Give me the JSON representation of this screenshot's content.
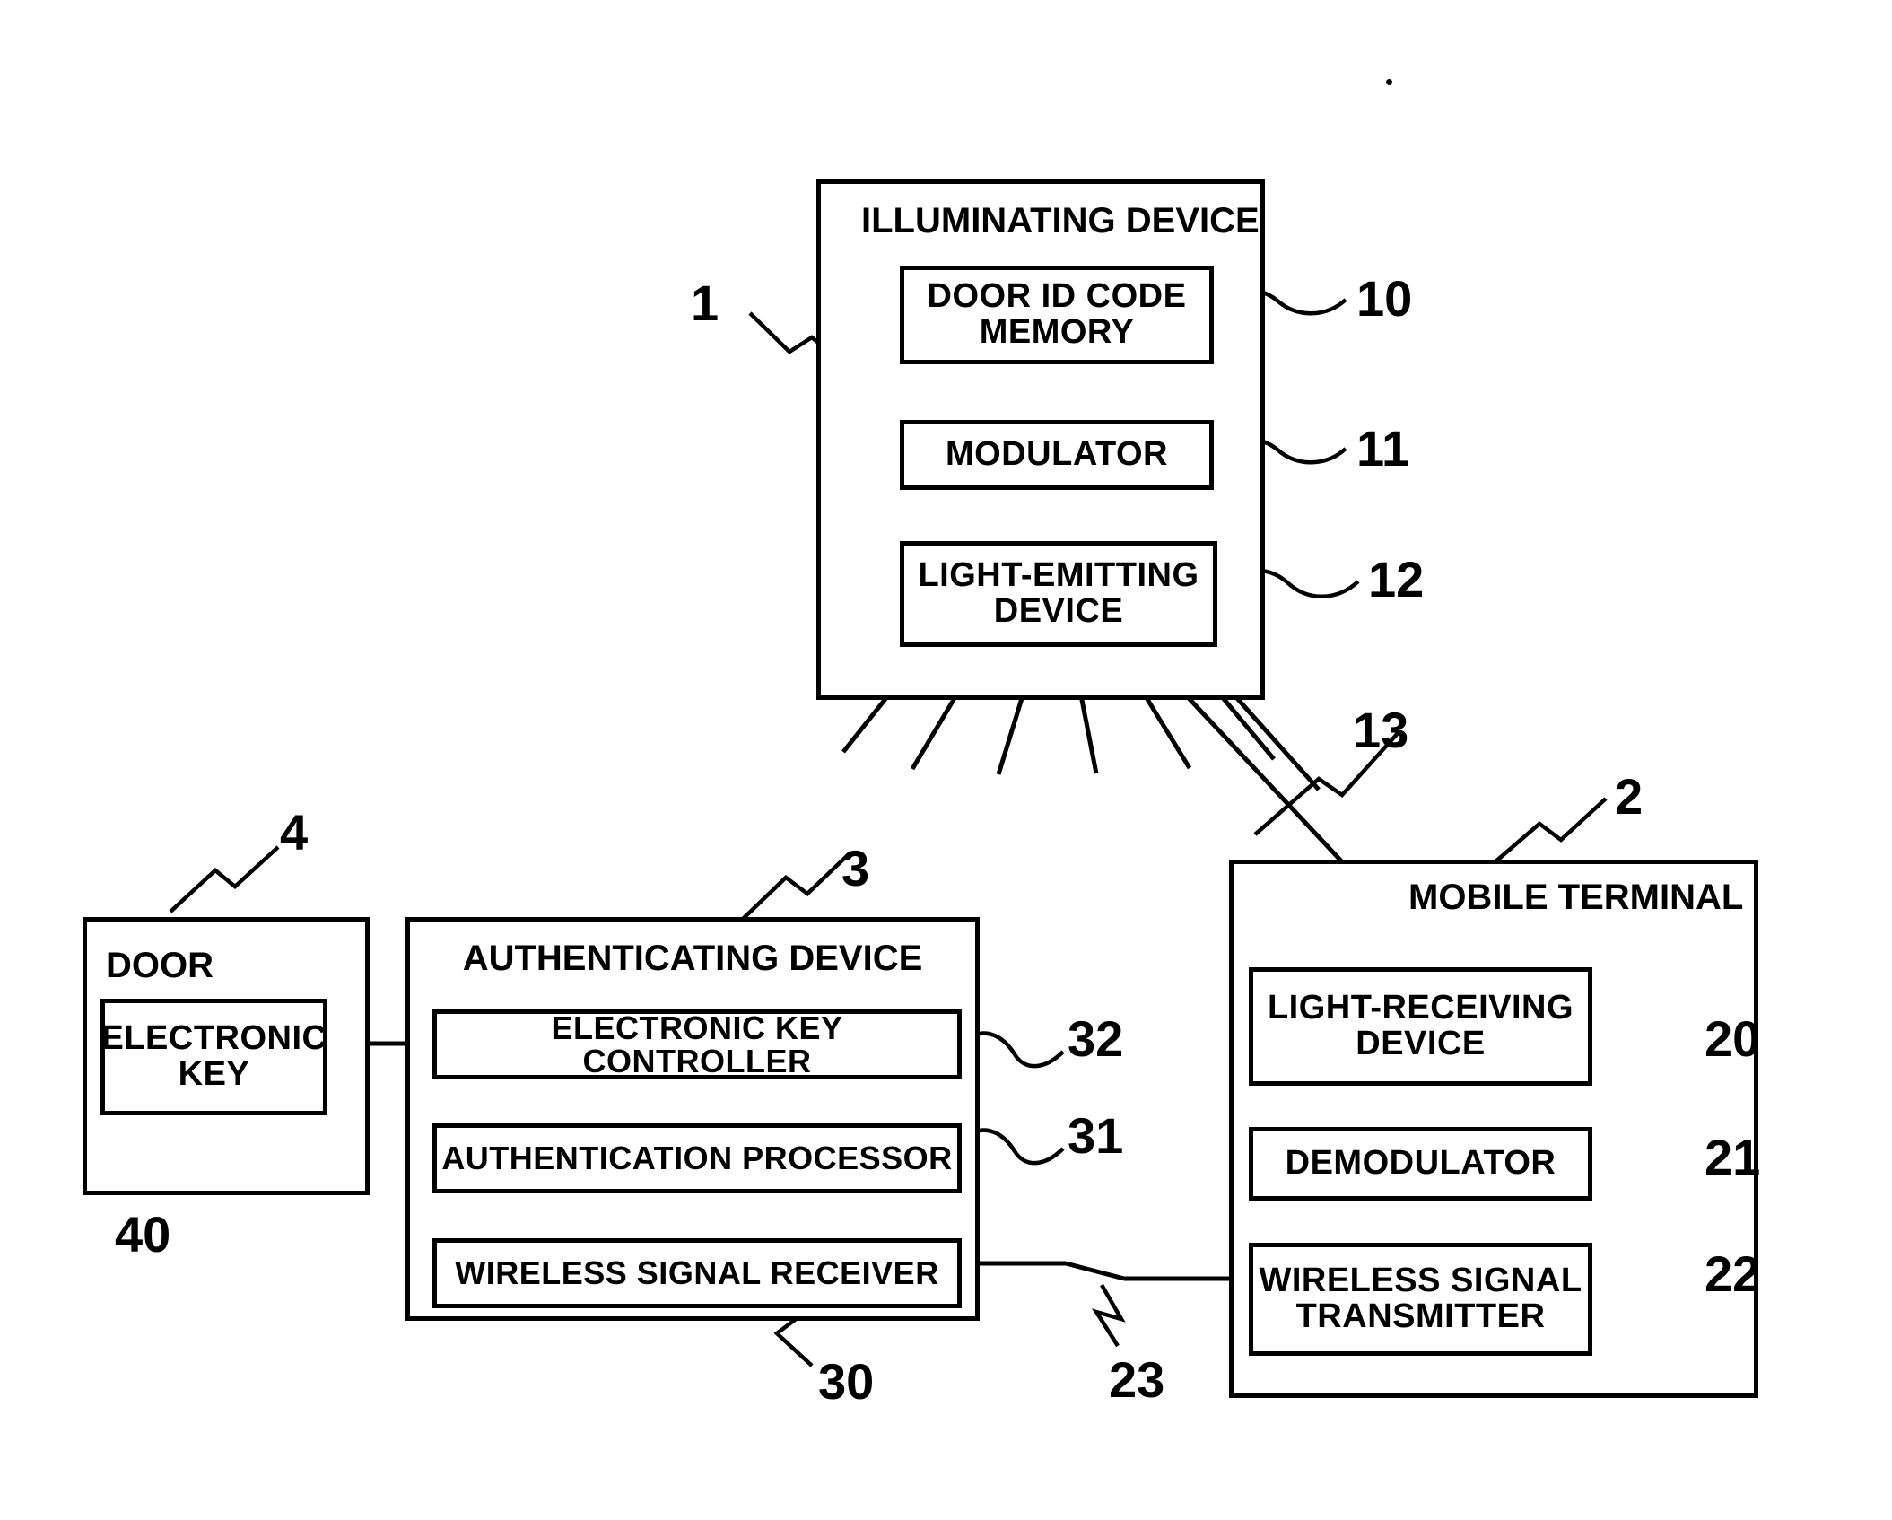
{
  "figure": {
    "type": "patent-block-diagram",
    "dot_mark": "·"
  },
  "illuminating_device": {
    "title": "ILLUMINATING DEVICE",
    "ref": "1",
    "blocks": [
      {
        "label": "DOOR ID CODE\nMEMORY",
        "line1": "DOOR ID CODE",
        "line2": "MEMORY",
        "ref": "10"
      },
      {
        "label": "MODULATOR",
        "line1": "MODULATOR",
        "line2": "",
        "ref": "11"
      },
      {
        "label": "LIGHT-EMITTING\nDEVICE",
        "line1": "LIGHT-EMITTING",
        "line2": "DEVICE",
        "ref": "12"
      }
    ],
    "light_beam_ref": "13"
  },
  "mobile_terminal": {
    "title": "MOBILE TERMINAL",
    "ref": "2",
    "blocks": [
      {
        "line1": "LIGHT-RECEIVING",
        "line2": "DEVICE",
        "ref": "20"
      },
      {
        "line1": "DEMODULATOR",
        "line2": "",
        "ref": "21"
      },
      {
        "line1": "WIRELESS SIGNAL",
        "line2": "TRANSMITTER",
        "ref": "22"
      }
    ],
    "wireless_link_ref": "23"
  },
  "authenticating_device": {
    "title": "AUTHENTICATING DEVICE",
    "ref": "3",
    "blocks": [
      {
        "line1": "ELECTRONIC KEY CONTROLLER",
        "line2": "",
        "ref": "32"
      },
      {
        "line1": "AUTHENTICATION PROCESSOR",
        "line2": "",
        "ref": "31"
      },
      {
        "line1": "WIRELESS SIGNAL RECEIVER",
        "line2": "",
        "ref": "30"
      }
    ]
  },
  "door": {
    "title": "DOOR",
    "ref": "4",
    "blocks": [
      {
        "line1": "ELECTRONIC",
        "line2": "KEY",
        "ref": "40"
      }
    ]
  }
}
